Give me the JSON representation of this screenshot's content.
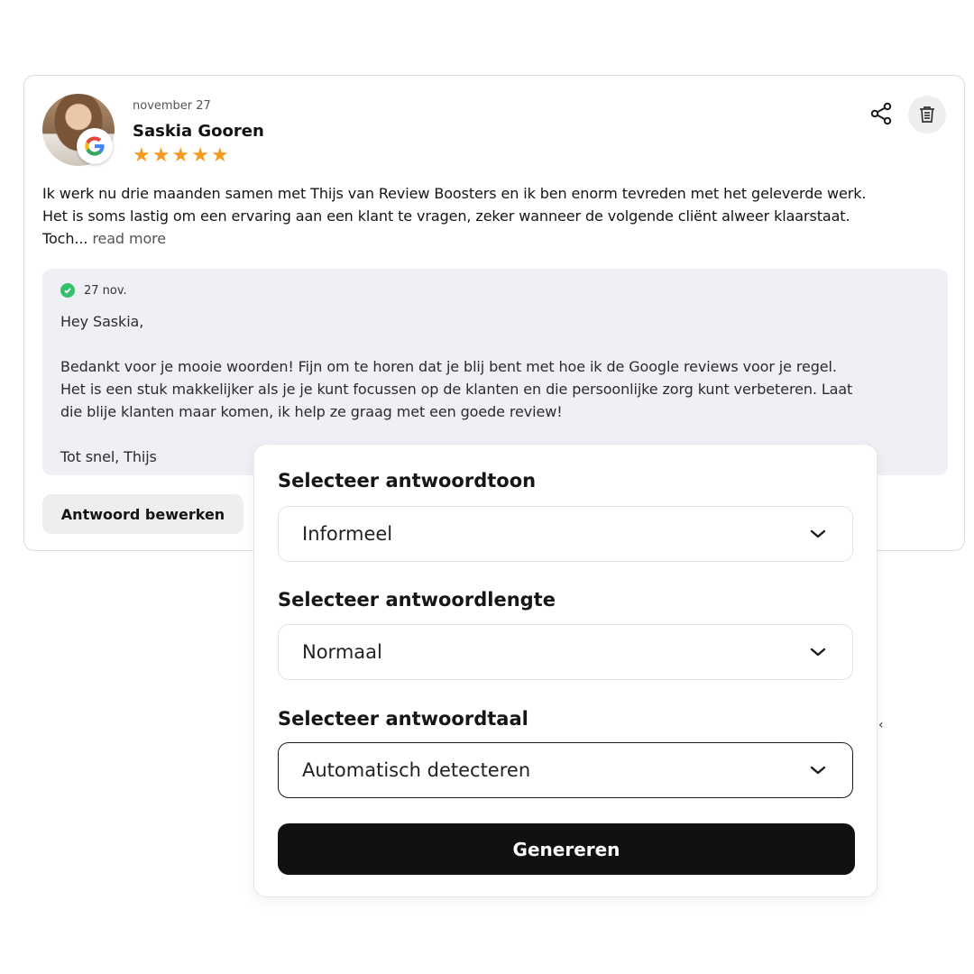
{
  "review": {
    "date": "november 27",
    "reviewer_name": "Saskia Gooren",
    "rating": 5,
    "source_badge": "G",
    "text_lines": [
      "Ik werk nu drie maanden samen met Thijs van Review Boosters en ik ben enorm tevreden met het geleverde werk.",
      "Het is soms lastig om een ervaring aan een klant te vragen, zeker wanneer de volgende cliënt alweer klaarstaat.",
      "Toch..."
    ],
    "read_more": "read more",
    "icons": {
      "share": "share-icon",
      "delete": "trash-icon"
    }
  },
  "reply": {
    "date": "27 nov.",
    "status_color": "#37c06b",
    "lines": [
      "Hey Saskia,",
      "",
      "Bedankt voor je mooie woorden! Fijn om te horen dat je blij bent met hoe ik de Google reviews voor je regel.",
      "Het is een stuk makkelijker als je je kunt focussen op de klanten en die persoonlijke zorg kunt verbeteren. Laat",
      "die blije klanten maar komen, ik help ze graag met een goede review!",
      "",
      "Tot snel, Thijs"
    ]
  },
  "edit_button_label": "Antwoord bewerken",
  "stray_glyph": "‹",
  "panel": {
    "tone_label": "Selecteer antwoordtoon",
    "tone_value": "Informeel",
    "length_label": "Selecteer antwoordlengte",
    "length_value": "Normaal",
    "language_label": "Selecteer antwoordtaal",
    "language_value": "Automatisch detecteren",
    "generate_label": "Genereren"
  },
  "colors": {
    "star": "#f59a1d",
    "button_dark": "#111111",
    "reply_bg": "#eef0f6"
  }
}
